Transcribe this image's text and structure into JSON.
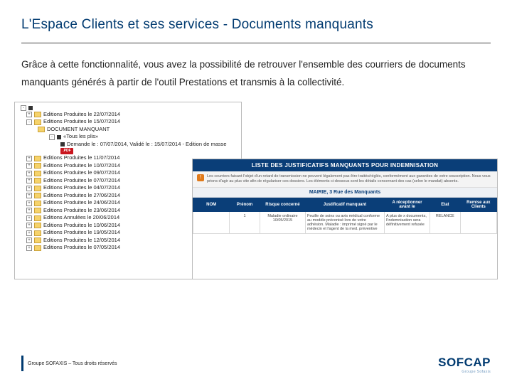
{
  "title": "L'Espace Clients et ses services - Documents manquants",
  "body": "Grâce à cette fonctionnalité, vous avez la possibilité de retrouver l'ensemble des courriers de documents manquants générés à partir de l'outil Prestations et transmis à la collectivité.",
  "tree": {
    "rows": [
      {
        "lvl": 0,
        "exp": "-",
        "ico": "node",
        "label": ""
      },
      {
        "lvl": 1,
        "exp": "+",
        "ico": "folder",
        "label": "Editions Produites le 22/07/2014"
      },
      {
        "lvl": 1,
        "exp": "-",
        "ico": "folder",
        "label": "Editions Produites le 15/07/2014"
      },
      {
        "lvl": 2,
        "exp": "",
        "ico": "folder",
        "label": "DOCUMENT MANQUANT"
      },
      {
        "lvl": 3,
        "exp": "-",
        "ico": "node",
        "label": "«Tous les plis»"
      },
      {
        "lvl": 4,
        "exp": "",
        "ico": "node",
        "label": "Demande le : 07/07/2014, Validé le : 15/07/2014 - Edition de masse"
      },
      {
        "lvl": 4,
        "exp": "",
        "ico": "pdf",
        "label": ""
      },
      {
        "lvl": 1,
        "exp": "+",
        "ico": "folder",
        "label": "Editions Produites le 11/07/2014"
      },
      {
        "lvl": 1,
        "exp": "+",
        "ico": "folder",
        "label": "Editions Produites le 10/07/2014"
      },
      {
        "lvl": 1,
        "exp": "+",
        "ico": "folder",
        "label": "Editions Produites le 09/07/2014"
      },
      {
        "lvl": 1,
        "exp": "+",
        "ico": "folder",
        "label": "Editions Produites le 07/07/2014"
      },
      {
        "lvl": 1,
        "exp": "+",
        "ico": "folder",
        "label": "Editions Produites le 04/07/2014"
      },
      {
        "lvl": 1,
        "exp": "+",
        "ico": "folder",
        "label": "Editions Produites le 27/06/2014"
      },
      {
        "lvl": 1,
        "exp": "+",
        "ico": "folder",
        "label": "Editions Produites le 24/06/2014"
      },
      {
        "lvl": 1,
        "exp": "+",
        "ico": "folder",
        "label": "Editions Produites le 23/06/2014"
      },
      {
        "lvl": 1,
        "exp": "+",
        "ico": "folder",
        "label": "Editions Annulées le 20/06/2014"
      },
      {
        "lvl": 1,
        "exp": "+",
        "ico": "folder",
        "label": "Editions Produites le 10/06/2014"
      },
      {
        "lvl": 1,
        "exp": "+",
        "ico": "folder",
        "label": "Editions Produites le 19/05/2014"
      },
      {
        "lvl": 1,
        "exp": "+",
        "ico": "folder",
        "label": "Editions Produites le 12/05/2014"
      },
      {
        "lvl": 1,
        "exp": "+",
        "ico": "folder",
        "label": "Editions Produites le 07/05/2014"
      }
    ]
  },
  "list": {
    "header": "LISTE DES JUSTIFICATIFS MANQUANTS POUR INDEMNISATION",
    "warn_icon": "!",
    "warn_text": "Les courriers faisant l'objet d'un retard de transmission ne peuvent légalement pas être traités/réglés, conformément aux garanties de votre souscription. Nous vous prions d'agir au plus vite afin de régulariser ces dossiers. Les éléments ci-dessous sont les détails concernant des cas (selon le mandat) absents.",
    "subheader": "MAIRIE, 3 Rue des Manquants",
    "columns": [
      "NOM",
      "Prénom",
      "Risque concerné",
      "Justificatif manquant",
      "A réceptionner avant le",
      "Etat",
      "Remise aux Clients"
    ],
    "row": {
      "nom": "",
      "prenom": "1",
      "risque": "Maladie ordinaire\n10/05/2015",
      "justif": "Feuille de soins ou avis médical conforme au modèle préconisé lors de votre adhésion. Maladie : imprimé signé par le médecin et l'agent de la med. préventive",
      "recep": "A plus de x documents, l'indemnisation sera définitivement refusée",
      "etat": "RELANCE",
      "remise": ""
    }
  },
  "footer": "Groupe SOFAXIS – Tous droits réservés",
  "brand": {
    "main": "SOFCAP",
    "sub": "Groupe Sofaxis"
  }
}
